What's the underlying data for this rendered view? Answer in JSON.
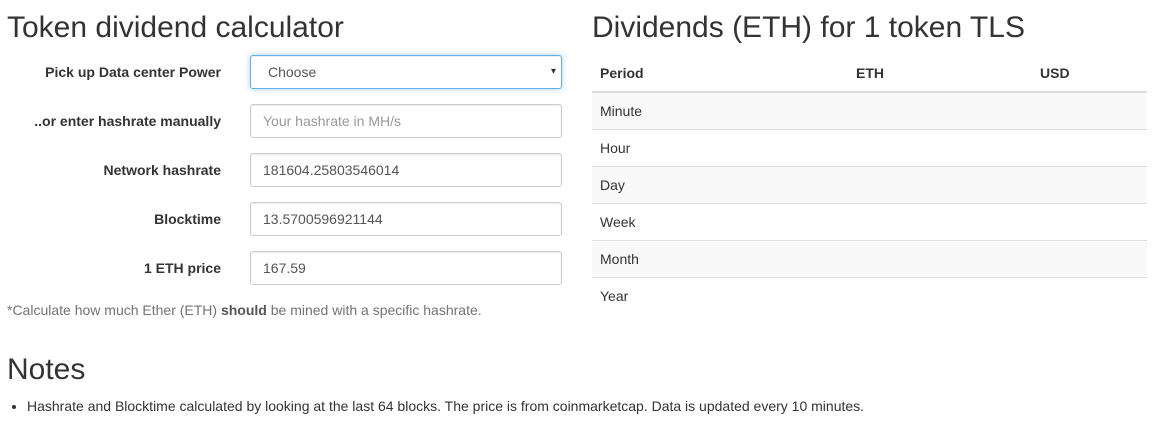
{
  "calculator": {
    "title": "Token dividend calculator",
    "datacenter": {
      "label": "Pick up Data center Power",
      "selected": "Choose"
    },
    "hashrate": {
      "label": "..or enter hashrate manually",
      "placeholder": "Your hashrate in MH/s",
      "value": ""
    },
    "network": {
      "label": "Network hashrate",
      "value": "181604.25803546014"
    },
    "blocktime": {
      "label": "Blocktime",
      "value": "13.5700596921144"
    },
    "ethprice": {
      "label": "1 ETH price",
      "value": "167.59"
    },
    "footnote": {
      "prefix": "*Calculate how much Ether (ETH) ",
      "bold": "should",
      "suffix": " be mined with a specific hashrate."
    }
  },
  "dividends": {
    "title": "Dividends (ETH) for 1 token TLS",
    "headers": {
      "period": "Period",
      "eth": "ETH",
      "usd": "USD"
    },
    "rows": [
      {
        "period": "Minute",
        "eth": "",
        "usd": ""
      },
      {
        "period": "Hour",
        "eth": "",
        "usd": ""
      },
      {
        "period": "Day",
        "eth": "",
        "usd": ""
      },
      {
        "period": "Week",
        "eth": "",
        "usd": ""
      },
      {
        "period": "Month",
        "eth": "",
        "usd": ""
      },
      {
        "period": "Year",
        "eth": "",
        "usd": ""
      }
    ]
  },
  "notes": {
    "title": "Notes",
    "items": [
      "Hashrate and Blocktime calculated by looking at the last 64 blocks. The price is from coinmarketcap. Data is updated every 10 minutes."
    ]
  },
  "icons": {
    "select_caret": "▾"
  }
}
